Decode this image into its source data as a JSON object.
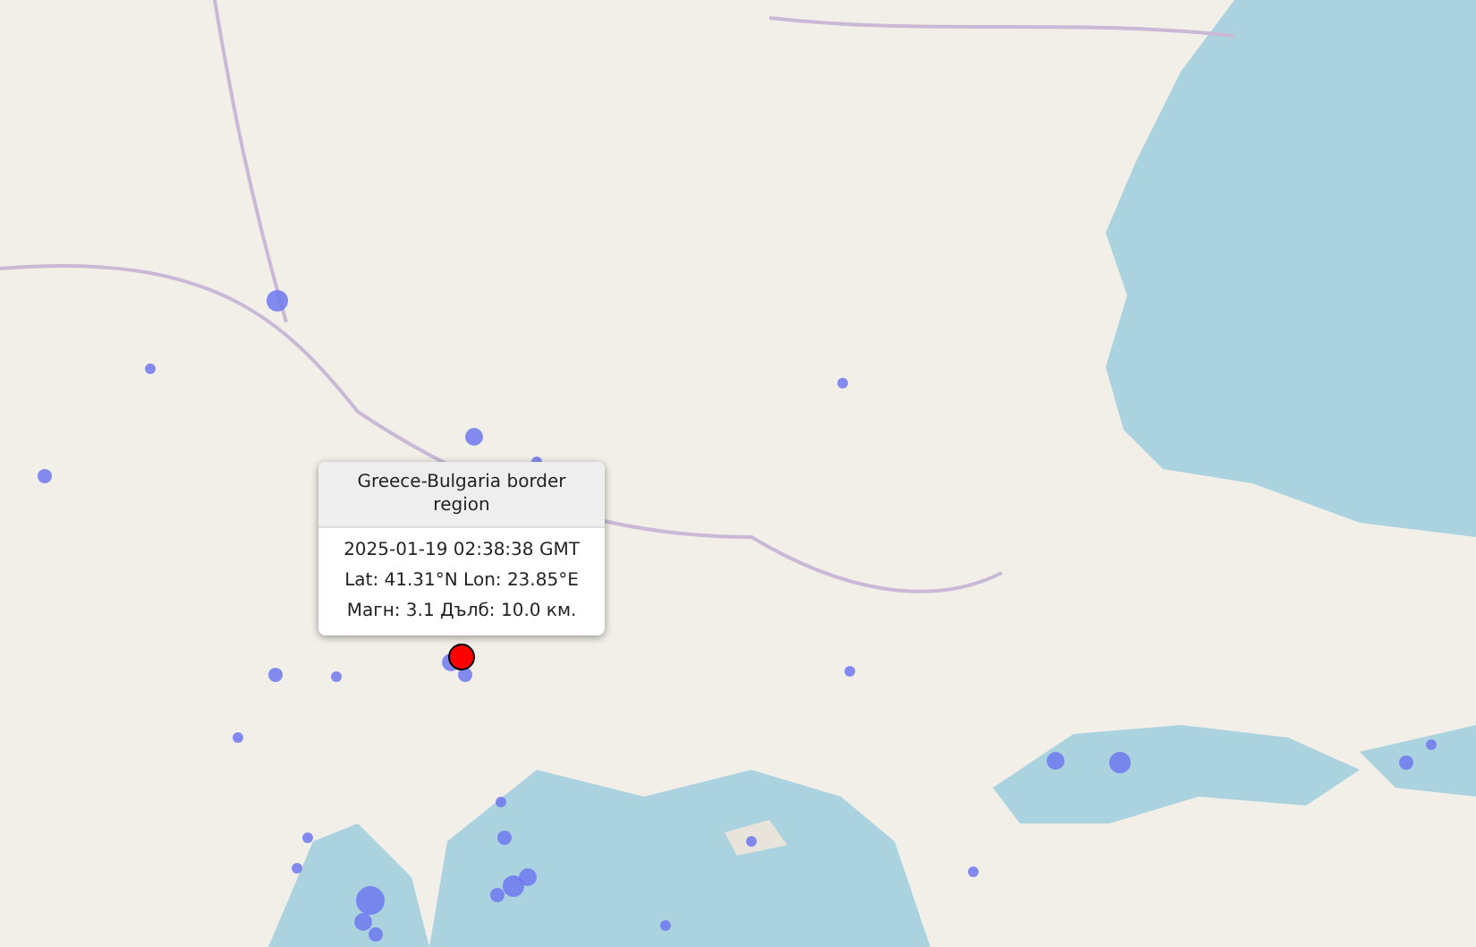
{
  "popup": {
    "title": "Greece-Bulgaria border region",
    "lines": [
      "2025-01-19 02:38:38 GMT",
      "Lat: 41.31°N Lon: 23.85°E",
      "Магн: 3.1 Дълб: 10.0 км."
    ]
  }
}
